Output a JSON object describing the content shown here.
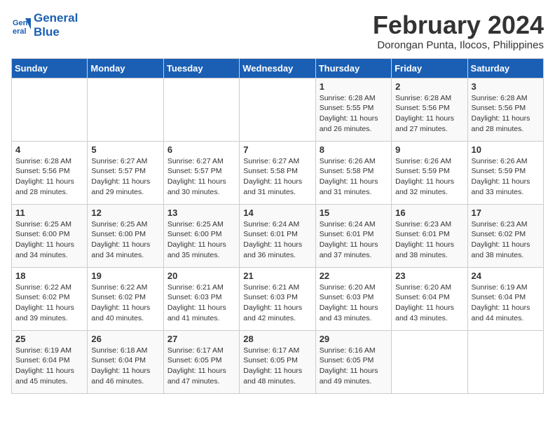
{
  "header": {
    "logo_line1": "General",
    "logo_line2": "Blue",
    "month_title": "February 2024",
    "location": "Dorongan Punta, Ilocos, Philippines"
  },
  "weekdays": [
    "Sunday",
    "Monday",
    "Tuesday",
    "Wednesday",
    "Thursday",
    "Friday",
    "Saturday"
  ],
  "weeks": [
    [
      {
        "day": "",
        "info": ""
      },
      {
        "day": "",
        "info": ""
      },
      {
        "day": "",
        "info": ""
      },
      {
        "day": "",
        "info": ""
      },
      {
        "day": "1",
        "info": "Sunrise: 6:28 AM\nSunset: 5:55 PM\nDaylight: 11 hours\nand 26 minutes."
      },
      {
        "day": "2",
        "info": "Sunrise: 6:28 AM\nSunset: 5:56 PM\nDaylight: 11 hours\nand 27 minutes."
      },
      {
        "day": "3",
        "info": "Sunrise: 6:28 AM\nSunset: 5:56 PM\nDaylight: 11 hours\nand 28 minutes."
      }
    ],
    [
      {
        "day": "4",
        "info": "Sunrise: 6:28 AM\nSunset: 5:56 PM\nDaylight: 11 hours\nand 28 minutes."
      },
      {
        "day": "5",
        "info": "Sunrise: 6:27 AM\nSunset: 5:57 PM\nDaylight: 11 hours\nand 29 minutes."
      },
      {
        "day": "6",
        "info": "Sunrise: 6:27 AM\nSunset: 5:57 PM\nDaylight: 11 hours\nand 30 minutes."
      },
      {
        "day": "7",
        "info": "Sunrise: 6:27 AM\nSunset: 5:58 PM\nDaylight: 11 hours\nand 31 minutes."
      },
      {
        "day": "8",
        "info": "Sunrise: 6:26 AM\nSunset: 5:58 PM\nDaylight: 11 hours\nand 31 minutes."
      },
      {
        "day": "9",
        "info": "Sunrise: 6:26 AM\nSunset: 5:59 PM\nDaylight: 11 hours\nand 32 minutes."
      },
      {
        "day": "10",
        "info": "Sunrise: 6:26 AM\nSunset: 5:59 PM\nDaylight: 11 hours\nand 33 minutes."
      }
    ],
    [
      {
        "day": "11",
        "info": "Sunrise: 6:25 AM\nSunset: 6:00 PM\nDaylight: 11 hours\nand 34 minutes."
      },
      {
        "day": "12",
        "info": "Sunrise: 6:25 AM\nSunset: 6:00 PM\nDaylight: 11 hours\nand 34 minutes."
      },
      {
        "day": "13",
        "info": "Sunrise: 6:25 AM\nSunset: 6:00 PM\nDaylight: 11 hours\nand 35 minutes."
      },
      {
        "day": "14",
        "info": "Sunrise: 6:24 AM\nSunset: 6:01 PM\nDaylight: 11 hours\nand 36 minutes."
      },
      {
        "day": "15",
        "info": "Sunrise: 6:24 AM\nSunset: 6:01 PM\nDaylight: 11 hours\nand 37 minutes."
      },
      {
        "day": "16",
        "info": "Sunrise: 6:23 AM\nSunset: 6:01 PM\nDaylight: 11 hours\nand 38 minutes."
      },
      {
        "day": "17",
        "info": "Sunrise: 6:23 AM\nSunset: 6:02 PM\nDaylight: 11 hours\nand 38 minutes."
      }
    ],
    [
      {
        "day": "18",
        "info": "Sunrise: 6:22 AM\nSunset: 6:02 PM\nDaylight: 11 hours\nand 39 minutes."
      },
      {
        "day": "19",
        "info": "Sunrise: 6:22 AM\nSunset: 6:02 PM\nDaylight: 11 hours\nand 40 minutes."
      },
      {
        "day": "20",
        "info": "Sunrise: 6:21 AM\nSunset: 6:03 PM\nDaylight: 11 hours\nand 41 minutes."
      },
      {
        "day": "21",
        "info": "Sunrise: 6:21 AM\nSunset: 6:03 PM\nDaylight: 11 hours\nand 42 minutes."
      },
      {
        "day": "22",
        "info": "Sunrise: 6:20 AM\nSunset: 6:03 PM\nDaylight: 11 hours\nand 43 minutes."
      },
      {
        "day": "23",
        "info": "Sunrise: 6:20 AM\nSunset: 6:04 PM\nDaylight: 11 hours\nand 43 minutes."
      },
      {
        "day": "24",
        "info": "Sunrise: 6:19 AM\nSunset: 6:04 PM\nDaylight: 11 hours\nand 44 minutes."
      }
    ],
    [
      {
        "day": "25",
        "info": "Sunrise: 6:19 AM\nSunset: 6:04 PM\nDaylight: 11 hours\nand 45 minutes."
      },
      {
        "day": "26",
        "info": "Sunrise: 6:18 AM\nSunset: 6:04 PM\nDaylight: 11 hours\nand 46 minutes."
      },
      {
        "day": "27",
        "info": "Sunrise: 6:17 AM\nSunset: 6:05 PM\nDaylight: 11 hours\nand 47 minutes."
      },
      {
        "day": "28",
        "info": "Sunrise: 6:17 AM\nSunset: 6:05 PM\nDaylight: 11 hours\nand 48 minutes."
      },
      {
        "day": "29",
        "info": "Sunrise: 6:16 AM\nSunset: 6:05 PM\nDaylight: 11 hours\nand 49 minutes."
      },
      {
        "day": "",
        "info": ""
      },
      {
        "day": "",
        "info": ""
      }
    ]
  ]
}
